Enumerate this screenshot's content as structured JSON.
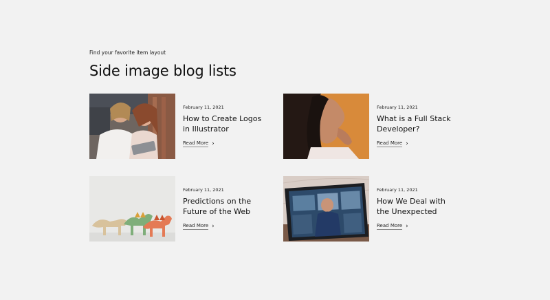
{
  "section": {
    "eyebrow": "Find your favorite item layout",
    "heading": "Side image blog lists"
  },
  "posts": [
    {
      "date": "February 11, 2021",
      "title_line1": "How to Create Logos",
      "title_line2": "in Illustrator",
      "link": "Read More",
      "image": "two-women-with-tablet"
    },
    {
      "date": "February 11, 2021",
      "title_line1": "What is a Full Stack",
      "title_line2": "Developer?",
      "link": "Read More",
      "image": "woman-profile-orange"
    },
    {
      "date": "February 11, 2021",
      "title_line1": "Predictions on the",
      "title_line2": "Future of the Web",
      "link": "Read More",
      "image": "wooden-dinosaur-toys"
    },
    {
      "date": "February 11, 2021",
      "title_line1": "How We Deal with",
      "title_line2": "the Unexpected",
      "link": "Read More",
      "image": "tablet-on-marble"
    }
  ],
  "icons": {
    "link_arrow": "chevron-right-icon"
  }
}
